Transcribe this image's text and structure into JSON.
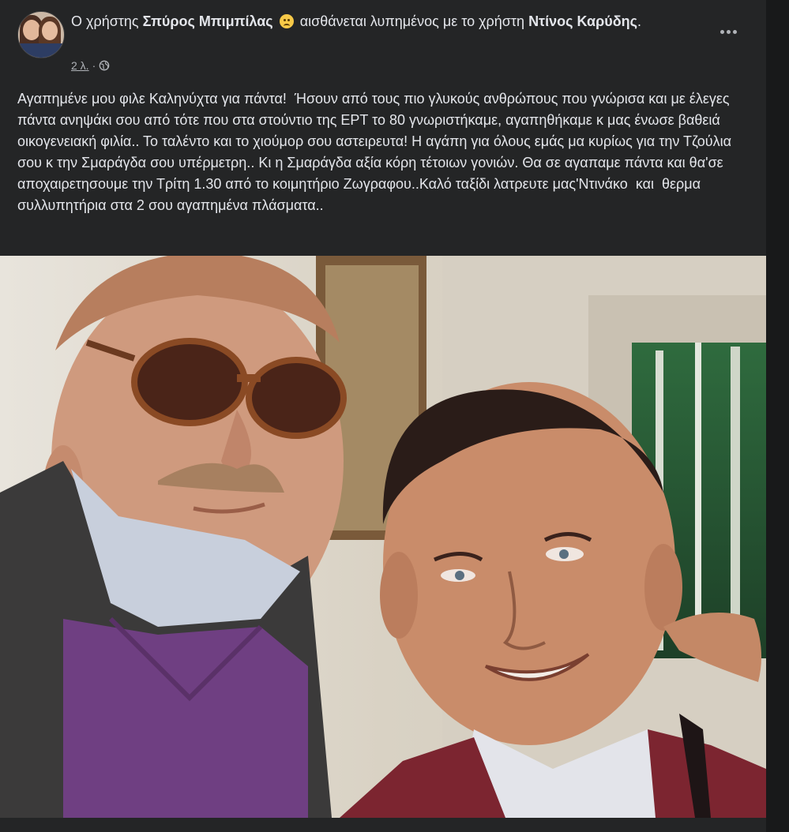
{
  "post": {
    "header": {
      "prefix": "Ο χρήστης",
      "author": "Σπύρος Μπιμπίλας",
      "feeling": "αισθάνεται λυπημένος με το χρήστη",
      "tagged": "Ντίνος Καρύδης",
      "suffix": ".",
      "feeling_icon": "sad-face-emoji",
      "time": "2 λ.",
      "dot": "·",
      "privacy_icon": "globe-icon"
    },
    "more_icon": "more-options-icon",
    "text": "Αγαπημένε μου φιλε Καληνύχτα για πάντα!  Ήσουν από τους πιο γλυκούς ανθρώπους που γνώρισα και με έλεγες πάντα ανηψάκι σου από τότε που στα στούντιο της ΕΡΤ το 80 γνωριστήκαμε, αγαπηθήκαμε κ μας ένωσε βαθειά οικογενειακή φιλία.. Το ταλέντο και το χιούμορ σου αστειρευτα! Η αγάπη για όλους εμάς μα κυρίως για την Τζούλια σου κ την Σμαράγδα σου υπέρμετρη.. Κι η Σμαράγδα αξία κόρη τέτοιων γονιών. Θα σε αγαπαμε πάντα και θα'σε αποχαιρετησουμε την Τρίτη 1.30 από το κοιμητήριο Ζωγραφου..Καλό ταξίδι λατρευτε μας'Ντινάκο  και  θερμα συλλυπητήρια στα 2 σου αγαπημένα πλάσματα..",
    "colors": {
      "background": "#242526",
      "text": "#e4e6eb",
      "secondary_text": "#b0b3b8"
    }
  }
}
